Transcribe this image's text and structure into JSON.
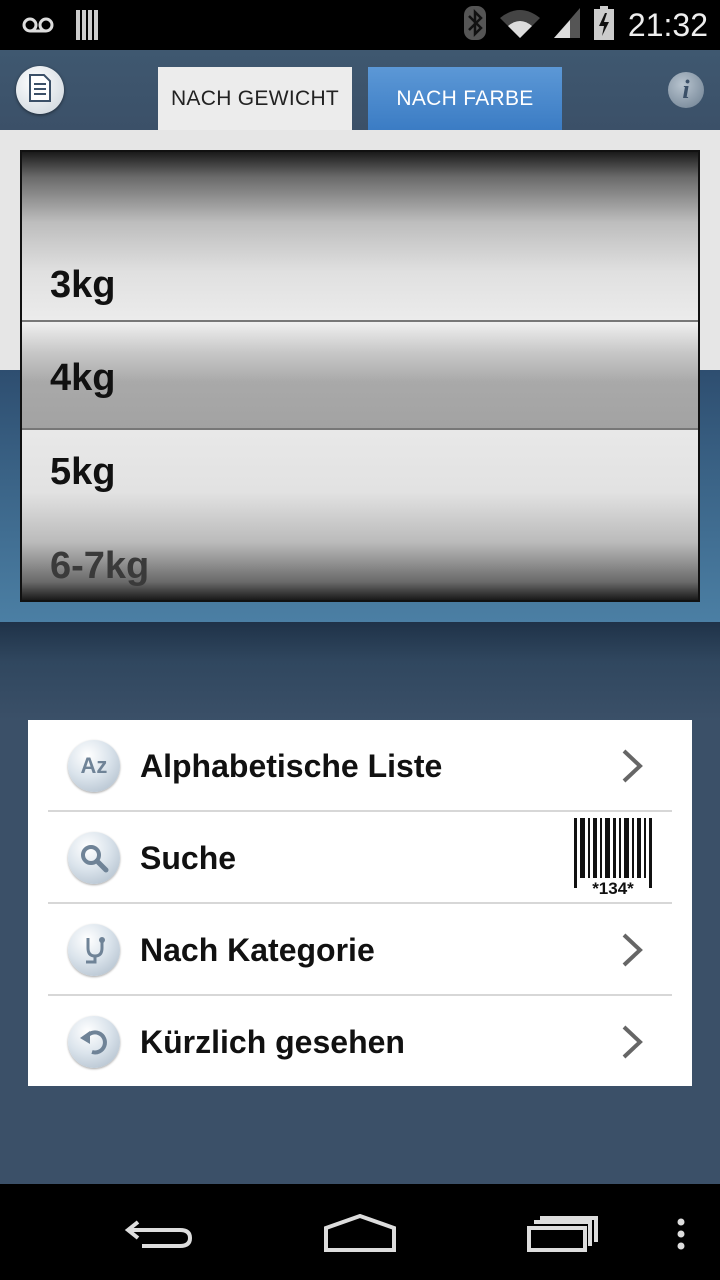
{
  "status_bar": {
    "time": "21:32",
    "icons": [
      "voicemail-icon",
      "notification-icon",
      "bluetooth-icon",
      "wifi-icon",
      "signal-icon",
      "battery-charging-icon"
    ]
  },
  "header": {
    "left_icon": "document-icon",
    "right_icon": "info-icon",
    "info_glyph": "i",
    "tabs": [
      {
        "label": "NACH GEWICHT",
        "selected": true
      },
      {
        "label": "NACH FARBE",
        "selected": false
      }
    ]
  },
  "picker": {
    "items": [
      "3kg",
      "4kg",
      "5kg",
      "6-7kg"
    ],
    "selected": "4kg"
  },
  "menu": {
    "items": [
      {
        "label": "Alphabetische Liste",
        "icon": "az-icon",
        "accessory": "chevron-right-icon"
      },
      {
        "label": "Suche",
        "icon": "search-icon",
        "accessory": "barcode-icon"
      },
      {
        "label": "Nach Kategorie",
        "icon": "category-icon",
        "accessory": "chevron-right-icon"
      },
      {
        "label": "Kürzlich gesehen",
        "icon": "history-icon",
        "accessory": "chevron-right-icon"
      }
    ],
    "barcode_text": "*134*",
    "az_glyph": "Az"
  },
  "nav_bar": {
    "icons": [
      "back-icon",
      "home-icon",
      "recent-apps-icon",
      "overflow-menu-icon"
    ]
  }
}
